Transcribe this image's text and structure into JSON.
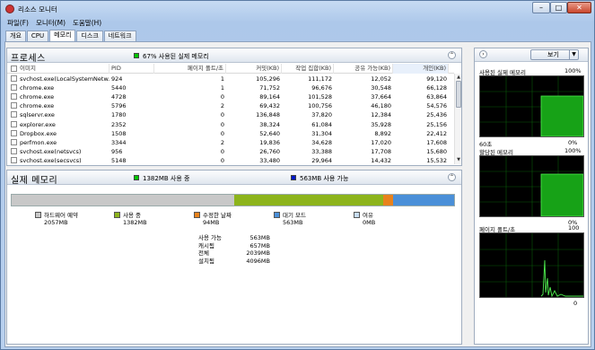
{
  "window": {
    "title": "리소스 모니터",
    "controls": {
      "minimize": "–",
      "maximize": "□",
      "close": "✕"
    }
  },
  "menu": [
    "파일(F)",
    "모니터(M)",
    "도움말(H)"
  ],
  "tabs": [
    "개요",
    "CPU",
    "메모리",
    "디스크",
    "네트워크"
  ],
  "active_tab": "메모리",
  "processes": {
    "title": "프로세스",
    "summary": "67% 사용된 실제 메모리",
    "summary_color": "#00c800",
    "columns": [
      "이미지",
      "PID",
      "페이지 폴트/초",
      "커밋(KB)",
      "작업 집합(KB)",
      "공유 가능(KB)",
      "개인(KB)"
    ],
    "rows": [
      [
        "svchost.exe(LocalSystemNetw...",
        "924",
        "1",
        "105,296",
        "111,172",
        "12,052",
        "99,120"
      ],
      [
        "chrome.exe",
        "5440",
        "1",
        "71,752",
        "96,676",
        "30,548",
        "66,128"
      ],
      [
        "chrome.exe",
        "4728",
        "0",
        "89,164",
        "101,528",
        "37,664",
        "63,864"
      ],
      [
        "chrome.exe",
        "5796",
        "2",
        "69,432",
        "100,756",
        "46,180",
        "54,576"
      ],
      [
        "sqlservr.exe",
        "1780",
        "0",
        "136,848",
        "37,820",
        "12,384",
        "25,436"
      ],
      [
        "explorer.exe",
        "2352",
        "0",
        "38,324",
        "61,084",
        "35,928",
        "25,156"
      ],
      [
        "Dropbox.exe",
        "1508",
        "0",
        "52,640",
        "31,304",
        "8,892",
        "22,412"
      ],
      [
        "perfmon.exe",
        "3344",
        "2",
        "19,836",
        "34,628",
        "17,020",
        "17,608"
      ],
      [
        "svchost.exe(netsvcs)",
        "956",
        "0",
        "26,760",
        "33,388",
        "17,708",
        "15,680"
      ],
      [
        "svchost.exe(secsvcs)",
        "5148",
        "0",
        "33,480",
        "29,964",
        "14,432",
        "15,532"
      ]
    ]
  },
  "physical": {
    "title": "실제 메모리",
    "in_use_label": "1382MB 사용 중",
    "available_label": "563MB 사용 가능",
    "bar": [
      {
        "name": "하드웨어 예약",
        "value_mb": 2057,
        "color": "#c8c8c8"
      },
      {
        "name": "사용 중",
        "value_mb": 1382,
        "color": "#8db41c"
      },
      {
        "name": "수정한 날짜",
        "value_mb": 94,
        "color": "#e8821c"
      },
      {
        "name": "대기 모드",
        "value_mb": 563,
        "color": "#4a8fd8"
      },
      {
        "name": "여유",
        "value_mb": 0,
        "color": "#c7ddf2"
      }
    ],
    "legend": [
      {
        "name": "하드웨어 예약",
        "value": "2057MB"
      },
      {
        "name": "사용 중",
        "value": "1382MB"
      },
      {
        "name": "수정한 날짜",
        "value": "94MB"
      },
      {
        "name": "대기 모드",
        "value": "563MB"
      },
      {
        "name": "여유",
        "value": "0MB"
      }
    ],
    "stats": [
      {
        "label": "사용 가능",
        "value": "563MB"
      },
      {
        "label": "캐시됨",
        "value": "657MB"
      },
      {
        "label": "전체",
        "value": "2039MB"
      },
      {
        "label": "설치됨",
        "value": "4096MB"
      }
    ]
  },
  "side": {
    "views_label": "보기",
    "graphs": [
      {
        "title": "사용된 실제 메모리",
        "top": "100%",
        "bottom_left": "60초",
        "bottom_right": "0%"
      },
      {
        "title": "할당된 메모리",
        "top": "100%",
        "bottom_right": "0%"
      },
      {
        "title": "페이지 폴트/초",
        "top": "100",
        "bottom_right": "0"
      }
    ]
  }
}
